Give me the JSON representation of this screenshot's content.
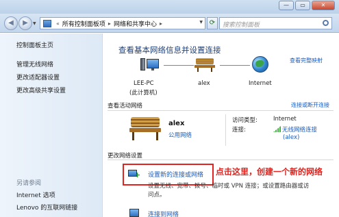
{
  "window": {
    "controls": [
      "—",
      "▭",
      "✕"
    ]
  },
  "address": {
    "overflow": "«",
    "crumbs": [
      "所有控制面板项",
      "网络和共享中心"
    ],
    "search_placeholder": "搜索控制面板"
  },
  "sidebar": {
    "home": "控制面板主页",
    "items": [
      "管理无线网络",
      "更改适配器设置",
      "更改高级共享设置"
    ],
    "see_also_label": "另请参阅",
    "see_also": [
      "Internet 选项",
      "Lenovo 的互联网链接"
    ]
  },
  "main": {
    "title": "查看基本网络信息并设置连接",
    "full_map_link": "查看完整映射",
    "map": {
      "computer_name": "LEE-PC",
      "computer_sub": "(此计算机)",
      "network": "alex",
      "internet": "Internet"
    },
    "active_networks": {
      "label": "查看活动网络",
      "connect_link": "连接或断开连接",
      "network_name": "alex",
      "network_type": "公用网络",
      "access_type_key": "访问类型:",
      "access_type_value": "Internet",
      "connections_key": "连接:",
      "connection_name": "无线网络连接",
      "connection_ssid": "(alex)"
    },
    "change_settings": {
      "label": "更改网络设置",
      "setup_link": "设置新的连接或网络",
      "setup_desc_line1": "设置无线、宽带、拨号、临时或 VPN 连接；或设置路由器或访",
      "setup_desc_line2": "问点。",
      "connect_link": "连接到网络"
    },
    "annotation": "点击这里，创建一个新的网络"
  },
  "colors": {
    "link": "#1a5bbf",
    "title": "#1e3f78",
    "annotation": "#e0231e"
  }
}
